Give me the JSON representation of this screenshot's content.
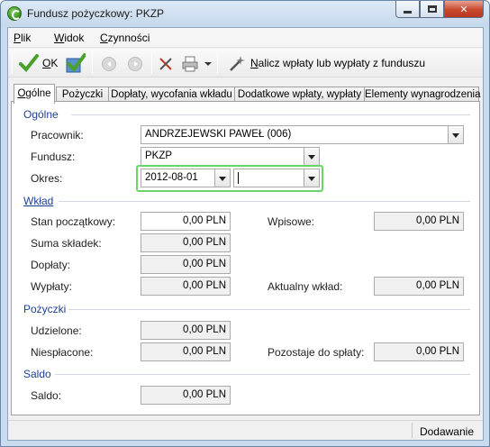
{
  "window": {
    "title": "Fundusz pożyczkowy: PKZP"
  },
  "menu": {
    "items": [
      {
        "label": "Plik",
        "accel": "P",
        "rest": "lik"
      },
      {
        "label": "Widok",
        "accel": "W",
        "rest": "idok"
      },
      {
        "label": "Czynności",
        "accel": "C",
        "rest": "zynności"
      }
    ]
  },
  "toolbar": {
    "ok_accel": "O",
    "ok_rest": "K",
    "compute_accel": "N",
    "compute_rest": "alicz wpłaty lub wypłaty z funduszu"
  },
  "tabs": [
    {
      "label": "Ogólne",
      "accel": "O",
      "rest": "gólne"
    },
    {
      "label": "Pożyczki"
    },
    {
      "label": "Dopłaty, wycofania wkładu"
    },
    {
      "label": "Dodatkowe wpłaty, wypłaty"
    },
    {
      "label": "Elementy wynagrodzenia"
    }
  ],
  "general": {
    "section_title": "Ogólne",
    "employee_label": "Pracownik:",
    "employee_value": "ANDRZEJEWSKI PAWEŁ (006)",
    "fund_label": "Fundusz:",
    "fund_value": "PKZP",
    "period_label": "Okres:",
    "period_from": "2012-08-01",
    "period_to": ""
  },
  "contribution": {
    "section_title": "Wkład",
    "initial_label": "Stan początkowy:",
    "initial_value": "0,00 PLN",
    "sum_label": "Suma składek:",
    "sum_value": "0,00 PLN",
    "topups_label": "Dopłaty:",
    "topups_value": "0,00 PLN",
    "payouts_label": "Wypłaty:",
    "payouts_value": "0,00 PLN",
    "entry_label": "Wpisowe:",
    "entry_value": "0,00 PLN",
    "current_label": "Aktualny wkład:",
    "current_value": "0,00 PLN"
  },
  "loans": {
    "section_title": "Pożyczki",
    "granted_label": "Udzielone:",
    "granted_value": "0,00 PLN",
    "unpaid_label": "Niespłacone:",
    "unpaid_value": "0,00 PLN",
    "remaining_label": "Pozostaje do spłaty:",
    "remaining_value": "0,00 PLN"
  },
  "balance": {
    "section_title": "Saldo",
    "balance_label": "Saldo:",
    "balance_value": "0,00 PLN"
  },
  "status": {
    "mode": "Dodawanie"
  },
  "colors": {
    "section": "#1c3f95",
    "focus": "#6ad36a"
  }
}
